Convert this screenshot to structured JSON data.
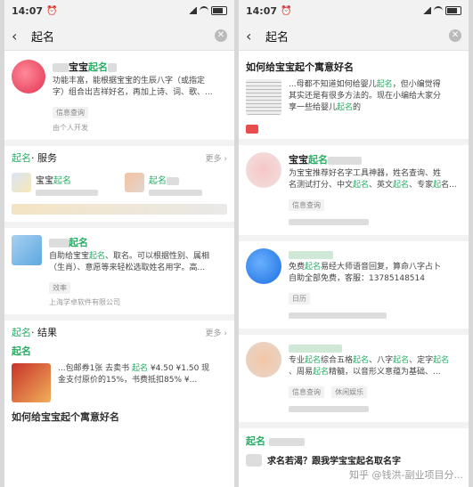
{
  "left": {
    "status": {
      "time": "14:07"
    },
    "search": {
      "query": "起名"
    },
    "top": {
      "name_parts": [
        "宝宝",
        "起名"
      ],
      "desc_lines": [
        "功能丰富，能根据宝宝的生辰八字（或指定",
        "字）组合出吉祥好名，再加上诗、词、歌、..."
      ],
      "tag": "信息查询",
      "dev": "由个人开发"
    },
    "services": {
      "title_hl": "起名",
      "title_rest": " · 服务",
      "more": "更多",
      "items": [
        {
          "name_parts": [
            "宝宝",
            "起名"
          ]
        },
        {
          "name_parts": [
            "起名"
          ]
        }
      ]
    },
    "app2": {
      "name": "起名",
      "desc_parts": [
        "自助给宝宝",
        "起名",
        "、取名。可以根据性别、属相",
        "（生肖）、意愿等来轻松选取姓名用字。高..."
      ],
      "tag": "效率",
      "company": "上海学卓软件有限公司"
    },
    "results": {
      "title_hl": "起名",
      "title_rest": " · 结果",
      "more": "更多",
      "label": "起名",
      "line1": "...包邮券1张 去卖书 ",
      "line1_hl": "起名",
      "line1_rest": " ¥4.50 ¥1.50 现",
      "line2": "金支付原价的15%，书费抵扣85% ¥...",
      "next_title": "如何给宝宝起个寓意好名"
    }
  },
  "right": {
    "status": {
      "time": "14:07"
    },
    "search": {
      "query": "起名"
    },
    "article": {
      "title": "如何给宝宝起个寓意好名",
      "desc_parts": [
        "...母都不知道如何给婴儿",
        "起名",
        "，但小编觉得",
        "其实还是有很多方法的。现在小编给大家分",
        "享一些给婴儿",
        "起名",
        "的"
      ]
    },
    "app1": {
      "name_parts": [
        "宝宝",
        "起名"
      ],
      "desc_parts": [
        "为宝宝推荐好名字工具神器，姓名查询、姓",
        "名测试打分、中文",
        "起名",
        "、英文",
        "起名",
        "、专家",
        "起",
        "名..."
      ],
      "tag": "信息查询"
    },
    "app2": {
      "desc_parts": [
        "免费",
        "起名",
        "易经大师语音回复，算命八字占卜",
        "自助全部免费，客服：13785148514"
      ],
      "tag": "日历"
    },
    "app3": {
      "desc_parts": [
        "专业",
        "起名",
        "综合五格",
        "起名",
        "、八字",
        "起名",
        "、定字",
        "起名",
        "、周易",
        "起名",
        "精髓，以音形义意蕴为基础、..."
      ],
      "tags": [
        "信息查询",
        "休闲娱乐"
      ]
    },
    "bottom": {
      "label": "起名",
      "question": "求名若渴？跟我学宝宝起名取名字"
    },
    "watermark": "知乎 @钱洪-副业项目分..."
  }
}
